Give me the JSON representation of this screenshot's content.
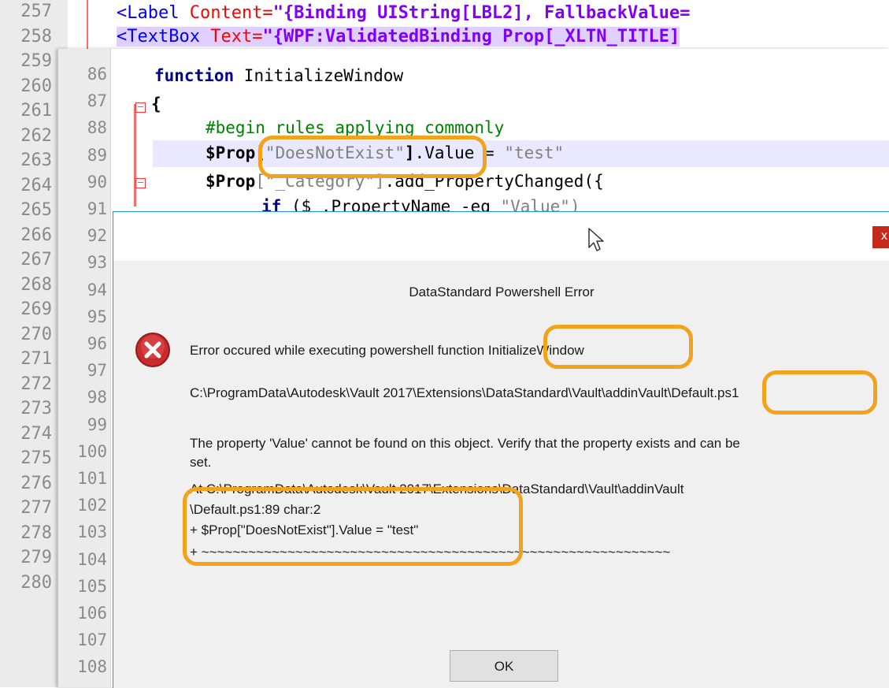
{
  "back_editor": {
    "line_numbers": [
      "257",
      "258",
      "259",
      "260",
      "261",
      "262",
      "263",
      "264",
      "265",
      "266",
      "267",
      "268",
      "269",
      "270",
      "271",
      "272",
      "273",
      "274",
      "275",
      "276",
      "277",
      "278",
      "279",
      "280"
    ],
    "line_257": {
      "tag": "<Label ",
      "attr": "Content=",
      "value": "\"{Binding UIString[LBL2], FallbackValue="
    },
    "line_258": {
      "tag": "<TextBox ",
      "attr": "Text=",
      "value": "\"{WPF:ValidatedBinding Prop[_XLTN_TITLE]"
    }
  },
  "front_editor": {
    "line_numbers": [
      "86",
      "87",
      "88",
      "89",
      "90",
      "91",
      "92",
      "93",
      "94",
      "95",
      "96",
      "97",
      "98",
      "99",
      "100",
      "101",
      "102",
      "103",
      "104",
      "105",
      "106",
      "107",
      "108"
    ],
    "code": {
      "l86_kw": "function",
      "l86_rest": " InitializeWindow",
      "l87": "{",
      "l88": "#begin rules applying commonly",
      "l89_var": "$Prop",
      "l89_bracket_open": "[",
      "l89_key": "\"DoesNotExist\"",
      "l89_bracket_close": "]",
      "l89_rest": ".Value = ",
      "l89_value": "\"test\"",
      "l90_var": "$Prop",
      "l90_key": "[\"_Category\"]",
      "l90_rest": ".add_PropertyChanged({",
      "l91_kw": "if",
      "l91_rest": " ($_.PropertyName -eq ",
      "l91_value": "\"Value\")"
    }
  },
  "dialog": {
    "close_label": "x",
    "heading": "DataStandard Powershell Error",
    "line1": "Error occured while executing powershell function InitializeWindow",
    "line2": "C:\\ProgramData\\Autodesk\\Vault 2017\\Extensions\\DataStandard\\Vault\\addinVault\\Default.ps1",
    "line3a": "The property 'Value' cannot be found on this object. Verify that the property exists and can be",
    "line3b": "set.",
    "line4": "At C:\\ProgramData\\Autodesk\\Vault 2017\\Extensions\\DataStandard\\Vault\\addinVault",
    "line5": "\\Default.ps1:89 char:2",
    "line6": "+     $Prop[\"DoesNotExist\"].Value = \"test\"",
    "line7": "+     ~~~~~~~~~~~~~~~~~~~~~~~~~~~~~~~~~~~~~~~~~~~~~~~~~~~~~~~~~~~~",
    "ok_label": "OK"
  },
  "colors": {
    "annotation": "#f3a21b",
    "keyword": "#00008b",
    "string": "#808080",
    "comment": "#008000",
    "close_button": "#c42b1c"
  }
}
